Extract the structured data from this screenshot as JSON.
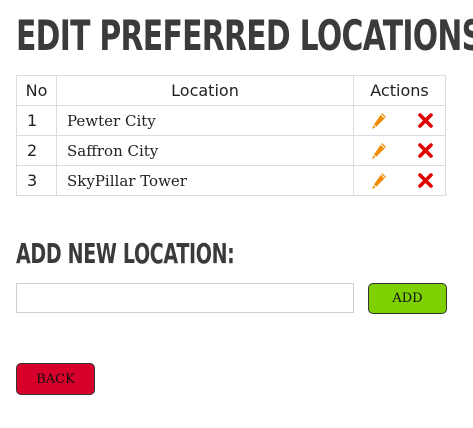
{
  "page": {
    "title": "EDIT PREFERRED LOCATIONS"
  },
  "table": {
    "headers": {
      "no": "No",
      "location": "Location",
      "actions": "Actions"
    },
    "rows": [
      {
        "no": "1",
        "location": "Pewter City"
      },
      {
        "no": "2",
        "location": "Saffron City"
      },
      {
        "no": "3",
        "location": "SkyPillar Tower"
      }
    ],
    "row_actions": {
      "edit_icon": "pencil-icon",
      "delete_icon": "x-icon"
    }
  },
  "add_section": {
    "heading": "ADD NEW LOCATION:",
    "input_value": "",
    "input_placeholder": "",
    "add_label": "ADD"
  },
  "back_label": "BACK",
  "colors": {
    "add_button": "#7ed000",
    "back_button": "#d6002a",
    "edit_icon": "#f08a00",
    "delete_icon": "#e00000",
    "heading_text": "#3b3b3b"
  }
}
